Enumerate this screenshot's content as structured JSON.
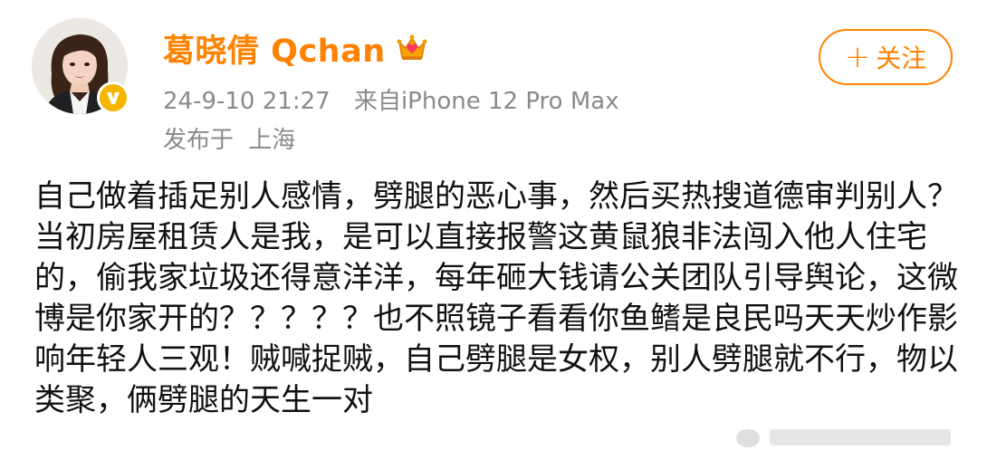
{
  "post": {
    "author": {
      "name": "葛晓倩 Qchan",
      "avatar_icon": "user-avatar",
      "verified_icon": "verified-v-icon",
      "vip_icon": "crown-icon",
      "name_color": "#ff8200"
    },
    "timestamp": "24-9-10 21:27",
    "source_prefix": "来自",
    "source_device": "iPhone 12 Pro Max",
    "location_prefix": "发布于",
    "location": "上海",
    "follow_button": {
      "plus": "+",
      "label": "关注",
      "color": "#ff8200"
    },
    "body": "自己做着插足别人感情，劈腿的恶心事，然后买热搜道德审判别人？当初房屋租赁人是我，是可以直接报警这黄鼠狼非法闯入他人住宅的，偷我家垃圾还得意洋洋，每年砸大钱请公关团队引导舆论，这微博是你家开的？？？？？也不照镜子看看你鱼鳍是良民吗天天炒作影响年轻人三观！贼喊捉贼，自己劈腿是女权，别人劈腿就不行，物以类聚，俩劈腿的天生一对"
  }
}
